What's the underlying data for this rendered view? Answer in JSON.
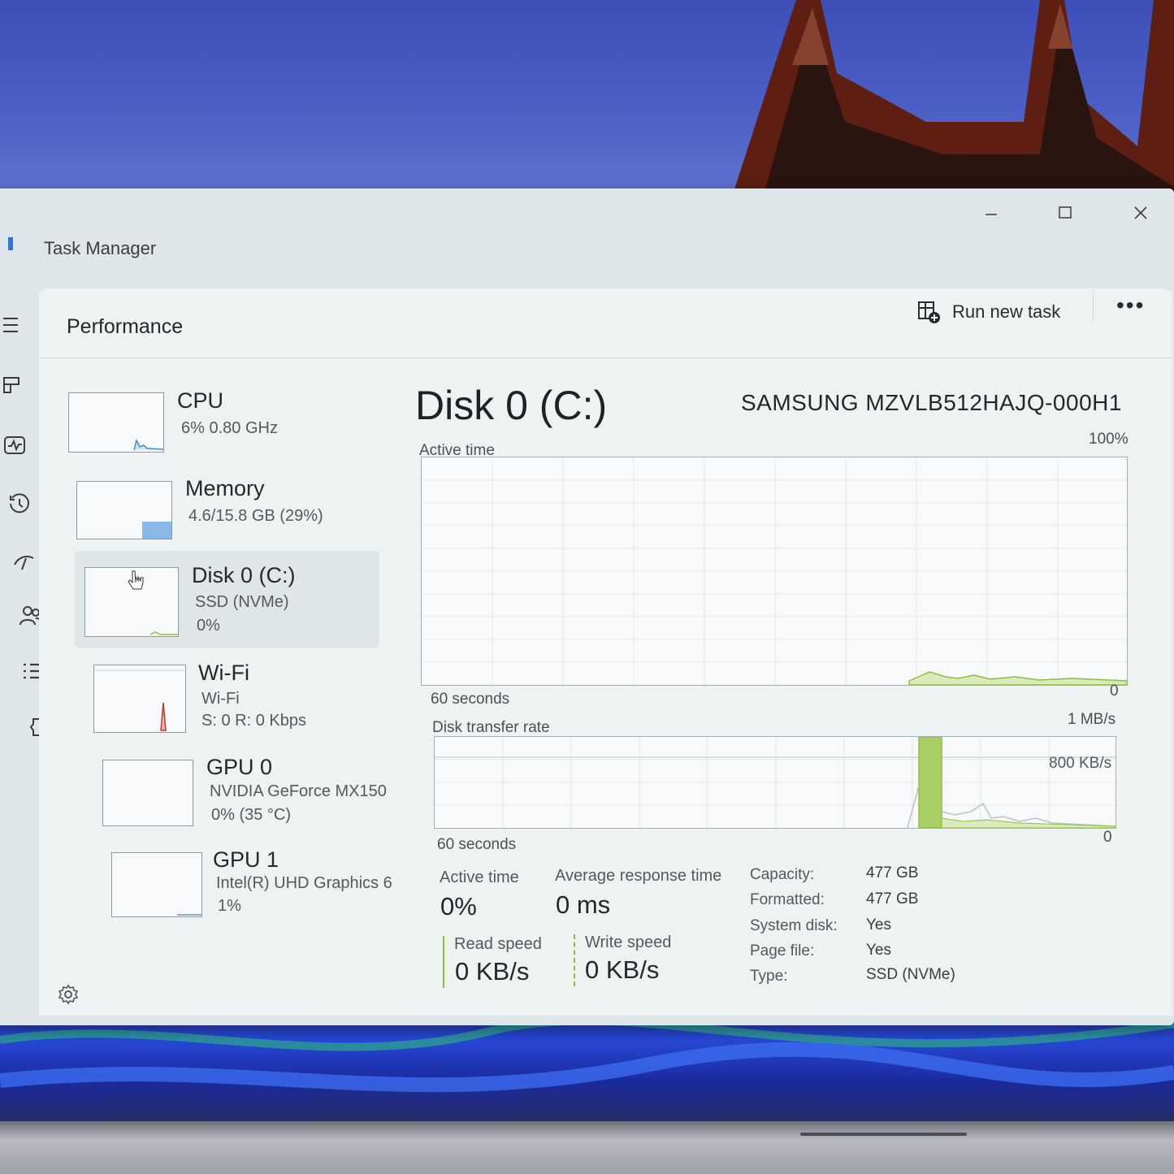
{
  "window": {
    "title": "Task Manager"
  },
  "header": {
    "section_title": "Performance",
    "run_new_task": "Run new task"
  },
  "devices": [
    {
      "name": "CPU",
      "line1": "6%  0.80 GHz",
      "line2": ""
    },
    {
      "name": "Memory",
      "line1": "4.6/15.8 GB (29%)",
      "line2": ""
    },
    {
      "name": "Disk 0 (C:)",
      "line1": "SSD (NVMe)",
      "line2": "0%"
    },
    {
      "name": "Wi-Fi",
      "line1": "Wi-Fi",
      "line2": "S: 0  R: 0 Kbps"
    },
    {
      "name": "GPU 0",
      "line1": "NVIDIA GeForce MX150",
      "line2": "0%  (35 °C)"
    },
    {
      "name": "GPU 1",
      "line1": "Intel(R) UHD Graphics 6",
      "line2": "1%"
    }
  ],
  "detail": {
    "title": "Disk 0 (C:)",
    "model": "SAMSUNG MZVLB512HAJQ-000H1",
    "active_time_graph": {
      "label": "Active time",
      "max": "100%",
      "x_span": "60 seconds",
      "min": "0"
    },
    "transfer_graph": {
      "label": "Disk transfer rate",
      "max": "1 MB/s",
      "mid": "800 KB/s",
      "x_span": "60 seconds",
      "min": "0"
    },
    "stats": {
      "active_time_label": "Active time",
      "active_time_value": "0%",
      "avg_response_label": "Average response time",
      "avg_response_value": "0 ms",
      "read_label": "Read speed",
      "read_value": "0 KB/s",
      "write_label": "Write speed",
      "write_value": "0 KB/s"
    },
    "properties": [
      {
        "k": "Capacity:",
        "v": "477 GB"
      },
      {
        "k": "Formatted:",
        "v": "477 GB"
      },
      {
        "k": "System disk:",
        "v": "Yes"
      },
      {
        "k": "Page file:",
        "v": "Yes"
      },
      {
        "k": "Type:",
        "v": "SSD (NVMe)"
      }
    ]
  },
  "colors": {
    "disk_accent": "#8fbf3a",
    "wifi_accent": "#c0392b",
    "cpu_accent": "#3e8ed0",
    "memory_accent": "#8ab8e6"
  },
  "icons": [
    "hamburger-icon",
    "processes-icon",
    "performance-icon",
    "app-history-icon",
    "startup-icon",
    "users-icon",
    "details-icon",
    "services-icon",
    "settings-icon",
    "run-task-icon",
    "more-icon"
  ]
}
